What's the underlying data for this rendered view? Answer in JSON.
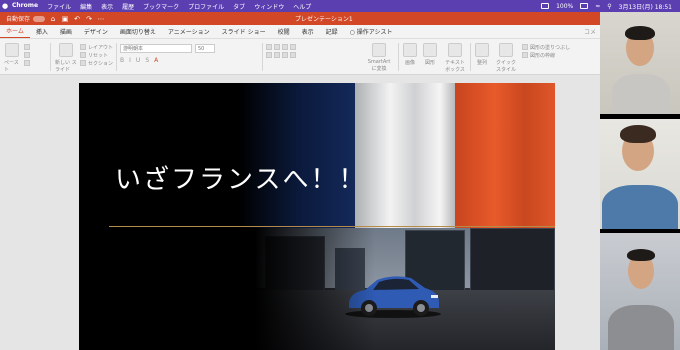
{
  "menubar": {
    "apple_icon": "",
    "app": "Chrome",
    "items": [
      "ファイル",
      "編集",
      "表示",
      "履歴",
      "ブックマーク",
      "プロファイル",
      "タブ",
      "ウィンドウ",
      "ヘルプ"
    ],
    "battery": "100%",
    "datetime": "3月13日(月) 18:51"
  },
  "titlebar": {
    "autosave_label": "自動保存",
    "autosave_state": "オフ",
    "document_title": "プレゼンテーション1"
  },
  "ribbon_tabs": {
    "items": [
      "ホーム",
      "挿入",
      "描画",
      "デザイン",
      "画面切り替え",
      "アニメーション",
      "スライド ショー",
      "校閲",
      "表示",
      "記録",
      "操作アシスト"
    ],
    "active": "ホーム",
    "comment": "コメ"
  },
  "ribbon": {
    "paste": "ペースト",
    "new_slide": "新しい スライド",
    "layout": "レイアウト",
    "reset": "リセット",
    "section": "セクション",
    "font": "游明朝本",
    "font_size": "50",
    "smartart": "SmartArt に変換",
    "picture": "画像",
    "shapes": "図形",
    "textbox": "テキスト ボックス",
    "arrange": "整列",
    "quick_styles": "クイック スタイル",
    "shape_fill": "図形の塗りつぶし",
    "shape_outline": "図形の枠線"
  },
  "slide": {
    "title": "いざフランスへ！！"
  },
  "colors": {
    "accent": "#d24726",
    "menubar": "#5b3fb0",
    "flag_blue": "#14295a",
    "flag_red": "#e0562a"
  }
}
